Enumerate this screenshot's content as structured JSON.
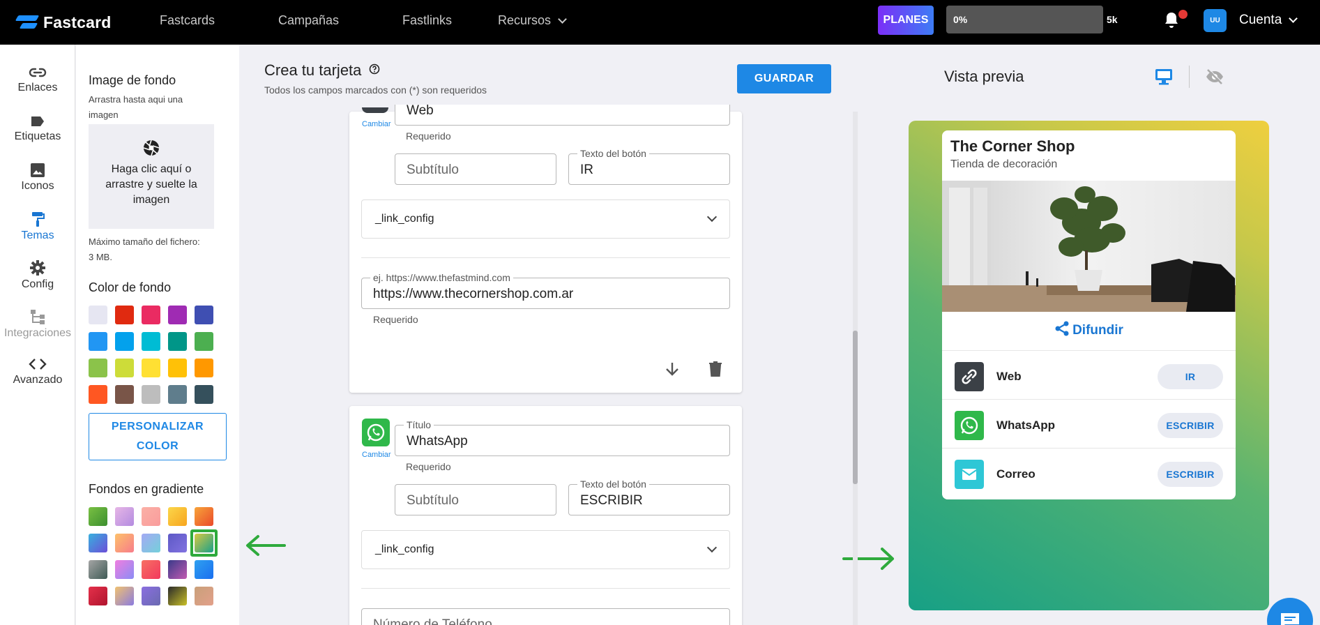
{
  "colors": {
    "accent": "#1e88e5",
    "topbar": "#000000",
    "selection": "#2eaa3c"
  },
  "topbar": {
    "logo_text": "Fastcard",
    "nav": [
      "Fastcards",
      "Campañas",
      "Fastlinks",
      "Recursos"
    ],
    "planes_label": "PLANES",
    "progress_text": "0%",
    "progress_value": 0,
    "progress_max": "5k",
    "avatar_initials": "UU",
    "account_label": "Cuenta"
  },
  "leftnav": {
    "items": [
      {
        "label": "Enlaces",
        "icon": "link-icon"
      },
      {
        "label": "Etiquetas",
        "icon": "label-icon"
      },
      {
        "label": "Iconos",
        "icon": "image-icon"
      },
      {
        "label": "Temas",
        "icon": "paint-roller-icon",
        "active": true
      },
      {
        "label": "Config",
        "icon": "gear-icon"
      },
      {
        "label": "Integraciones",
        "icon": "integrations-icon",
        "disabled": true
      },
      {
        "label": "Avanzado",
        "icon": "code-icon"
      }
    ]
  },
  "theme": {
    "bg_image_heading": "Image de fondo",
    "drag_hint_line1": "Arrastra hasta aqui una",
    "drag_hint_line2": "imagen",
    "dropzone_line1": "Haga clic aquí o",
    "dropzone_line2": "arrastre y suelte la",
    "dropzone_line3": "imagen",
    "max_size_line1": "Máximo tamaño del fichero:",
    "max_size_line2": "3 MB.",
    "bg_color_heading": "Color de fondo",
    "solid_colors": [
      "#e6e6f2",
      "#e02a10",
      "#ea2b62",
      "#9f2bb3",
      "#3f4fb2",
      "#2196f3",
      "#03a1ec",
      "#00bcd4",
      "#009688",
      "#4caf50",
      "#8bc34a",
      "#cddc39",
      "#ffe033",
      "#ffc107",
      "#ff9800",
      "#ff5722",
      "#795548",
      "#bdbdbd",
      "#5f7d8c",
      "#35505c"
    ],
    "custom_line1": "PERSONALIZAR",
    "custom_line2": "COLOR",
    "gradient_heading": "Fondos en gradiente",
    "gradients": [
      "linear-gradient(135deg,#79c043,#3c8f2f)",
      "linear-gradient(135deg,#e6b6e6,#b38be0)",
      "linear-gradient(135deg,#fbb0a6,#f99c9c)",
      "linear-gradient(135deg,#fbd64a,#f7a51f)",
      "linear-gradient(135deg,#f7a43a,#ea4a2a)",
      "linear-gradient(135deg,#38b0de,#6c4ed8)",
      "linear-gradient(135deg,#fdc16a,#f77c8a)",
      "linear-gradient(135deg,#a4a9f4,#74d0da)",
      "linear-gradient(135deg,#5d59c6,#8272e0)",
      "linear-gradient(135deg,#d6c842,#1aa08a)",
      "linear-gradient(135deg,#a5a5a5,#3f5a55)",
      "linear-gradient(135deg,#f07ee0,#8b8cf5)",
      "linear-gradient(135deg,#f77063,#f2385e)",
      "linear-gradient(135deg,#3a3a8a,#c15bb0)",
      "linear-gradient(135deg,#2fa0f0,#1a6ff0)",
      "linear-gradient(135deg,#e4304a,#b0142e)",
      "linear-gradient(135deg,#f0c170,#8b7be0)",
      "linear-gradient(135deg,#8a6ee0,#6a6ab0)",
      "linear-gradient(135deg,#2a2a2a,#c9c028)",
      "linear-gradient(135deg,#c9a07a,#e2a08a)"
    ],
    "selected_gradient_index": 9
  },
  "editor": {
    "title": "Crea tu tarjeta",
    "subtitle": "Todos los campos marcados con (*) son requeridos",
    "save_label": "GUARDAR",
    "cambiar": "Cambiar",
    "required": "Requerido",
    "subtitle_placeholder": "Subtítulo",
    "button_text_label": "Texto del botón",
    "title_label": "Título",
    "link_config": "_link_config",
    "card1": {
      "title_value": "Web",
      "button_text": "IR",
      "url_label": "ej. https://www.thefastmind.com",
      "url_value": "https://www.thecornershop.com.ar"
    },
    "card2": {
      "title_value": "WhatsApp",
      "button_text": "ESCRIBIR",
      "phone_placeholder": "Número de Teléfono"
    }
  },
  "preview": {
    "title": "Vista previa",
    "shop_name": "The Corner Shop",
    "shop_subtitle": "Tienda de decoración",
    "share_label": "Difundir",
    "links": [
      {
        "name": "Web",
        "button": "IR",
        "icon": "link-icon",
        "color": "#3b4046"
      },
      {
        "name": "WhatsApp",
        "button": "ESCRIBIR",
        "icon": "whatsapp-icon",
        "color": "#2fb84a"
      },
      {
        "name": "Correo",
        "button": "ESCRIBIR",
        "icon": "mail-icon",
        "color": "#2ec7d6"
      }
    ]
  }
}
